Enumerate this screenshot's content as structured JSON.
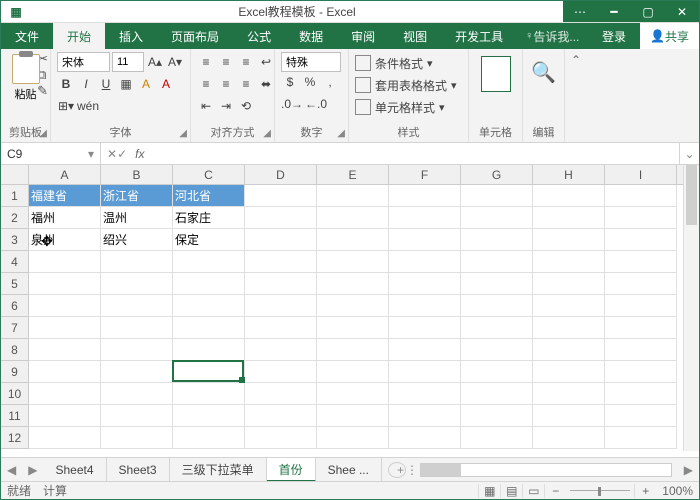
{
  "title": "Excel教程模板 - Excel",
  "menu": {
    "file": "文件",
    "home": "开始",
    "insert": "插入",
    "layout": "页面布局",
    "formula": "公式",
    "data": "数据",
    "review": "审阅",
    "view": "视图",
    "dev": "开发工具",
    "tell": "告诉我...",
    "login": "登录",
    "share": "共享"
  },
  "ribbon": {
    "clipboard": {
      "paste": "粘贴",
      "label": "剪贴板"
    },
    "font": {
      "name": "宋体",
      "size": "11",
      "label": "字体"
    },
    "align": {
      "label": "对齐方式"
    },
    "number": {
      "fmt": "特殊",
      "label": "数字"
    },
    "styles": {
      "cond": "条件格式",
      "table": "套用表格格式",
      "cell": "单元格样式",
      "label": "样式"
    },
    "cells": {
      "label": "单元格"
    },
    "edit": {
      "label": "编辑"
    }
  },
  "namebox": "C9",
  "formula": "",
  "columns": [
    "A",
    "B",
    "C",
    "D",
    "E",
    "F",
    "G",
    "H",
    "I"
  ],
  "rows": [
    "1",
    "2",
    "3",
    "4",
    "5",
    "6",
    "7",
    "8",
    "9",
    "10",
    "11",
    "12"
  ],
  "data": {
    "r1": {
      "A": "福建省",
      "B": "浙江省",
      "C": "河北省"
    },
    "r2": {
      "A": "福州",
      "B": "温州",
      "C": "石家庄"
    },
    "r3": {
      "A": "泉州",
      "B": "绍兴",
      "C": "保定"
    }
  },
  "selected": {
    "row": 9,
    "col": "C"
  },
  "tabs": {
    "items": [
      "Sheet4",
      "Sheet3",
      "三级下拉菜单",
      "首份",
      "Shee ..."
    ],
    "active": 3
  },
  "status": {
    "ready": "就绪",
    "calc": "计算",
    "zoom": "100%"
  },
  "chart_data": {
    "type": "table",
    "columns": [
      "福建省",
      "浙江省",
      "河北省"
    ],
    "rows": [
      [
        "福州",
        "温州",
        "石家庄"
      ],
      [
        "泉州",
        "绍兴",
        "保定"
      ]
    ]
  }
}
